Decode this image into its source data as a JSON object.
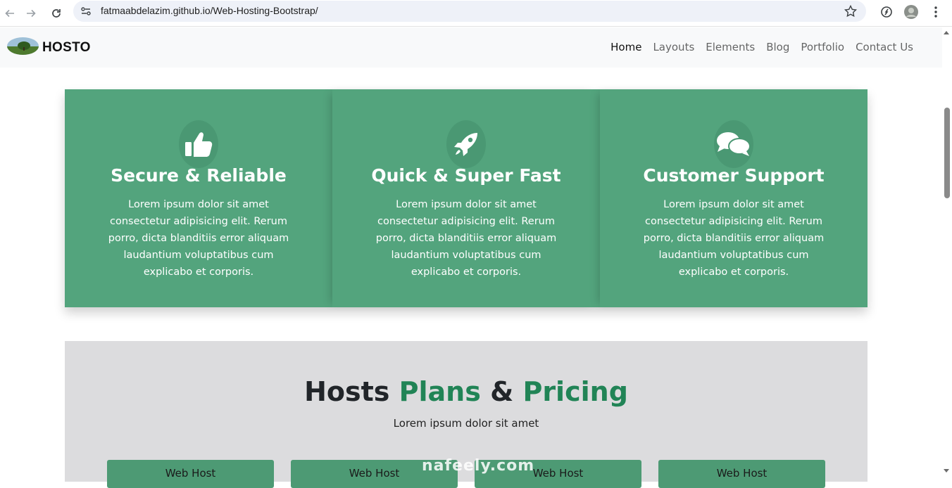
{
  "browser": {
    "url": "fatmaabdelazim.github.io/Web-Hosting-Bootstrap/"
  },
  "navbar": {
    "brand": "HOSTO",
    "links": [
      "Home",
      "Layouts",
      "Elements",
      "Blog",
      "Portfolio",
      "Contact Us"
    ],
    "active": "Home"
  },
  "features": [
    {
      "icon": "thumbs-up-icon",
      "title": "Secure & Reliable",
      "text": "Lorem ipsum dolor sit amet consectetur adipisicing elit. Rerum porro, dicta blanditiis error aliquam laudantium voluptatibus cum explicabo et corporis."
    },
    {
      "icon": "rocket-icon",
      "title": "Quick & Super Fast",
      "text": "Lorem ipsum dolor sit amet consectetur adipisicing elit. Rerum porro, dicta blanditiis error aliquam laudantium voluptatibus cum explicabo et corporis."
    },
    {
      "icon": "comments-icon",
      "title": "Customer Support",
      "text": "Lorem ipsum dolor sit amet consectetur adipisicing elit. Rerum porro, dicta blanditiis error aliquam laudantium voluptatibus cum explicabo et corporis."
    }
  ],
  "pricing": {
    "title_part1": "Hosts",
    "title_part2": "Plans",
    "title_part3": "&",
    "title_part4": "Pricing",
    "subtitle": "Lorem ipsum dolor sit amet",
    "plans": [
      "Web Host",
      "Web Host",
      "Web Host",
      "Web Host"
    ]
  },
  "watermark": "nafeely.com",
  "colors": {
    "feature_bg": "#53a47d",
    "accent_green": "#218456",
    "pricing_bg": "#dcdcde"
  }
}
